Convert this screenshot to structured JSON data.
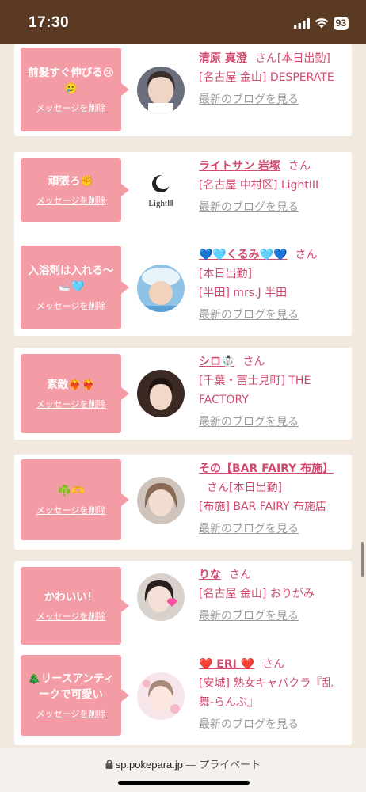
{
  "status": {
    "time": "17:30",
    "battery": "93"
  },
  "cards": [
    {
      "message": "前髪すぐ伸びる😢🥲",
      "delete": "メッセージを削除",
      "name": "清原 真澄",
      "san": "さん",
      "inline_extra": "[本日出勤]",
      "store": "[名古屋 金山] DESPERATE",
      "blog": "最新のブログを見る"
    },
    {
      "message": "頑張ろ✊",
      "delete": "メッセージを削除",
      "name": "ライトサン 岩塚",
      "san": "さん",
      "inline_extra": "",
      "store": "[名古屋 中村区] LightIII",
      "blog": "最新のブログを見る",
      "logo_text": "LightⅢ"
    },
    {
      "message": "入浴剤は入れる〜🛁🩵",
      "delete": "メッセージを削除",
      "name": "💙🩵くるみ🩵💙",
      "san": "さん",
      "inline_extra": "",
      "store": "[本日出勤]\n[半田] mrs.J 半田",
      "blog": "最新のブログを見る"
    },
    {
      "message": "素敵❤️‍🔥❤️‍🔥",
      "delete": "メッセージを削除",
      "name": "シロ☃️",
      "san": "さん",
      "inline_extra": "",
      "store": "[千葉・富士見町] THE FACTORY",
      "blog": "最新のブログを見る"
    },
    {
      "message": "☘️🫶",
      "delete": "メッセージを削除",
      "name": "その【BAR FAIRY 布施】",
      "san": "さん",
      "inline_extra": "[本日出勤]",
      "store": "[布施] BAR FAIRY 布施店",
      "blog": "最新のブログを見る"
    },
    {
      "message": "かわいい！",
      "delete": "メッセージを削除",
      "name": "りな",
      "san": "さん",
      "inline_extra": "",
      "store": "[名古屋 金山] おりがみ",
      "blog": "最新のブログを見る"
    },
    {
      "message": "🎄リースアンティークで可愛い",
      "delete": "メッセージを削除",
      "name": "❤️ ERI ❤️",
      "san": "さん",
      "inline_extra": "",
      "store": "[安城] 熟女キャバクラ『乱舞-らんぶ』",
      "blog": "最新のブログを見る"
    }
  ],
  "browser": {
    "url": "sp.pokepara.jp",
    "separator": "—",
    "mode": "プライベート"
  },
  "icons": [
    "signal-icon",
    "wifi-icon",
    "battery-icon",
    "lock-icon"
  ],
  "colors": {
    "bubble": "#f49ca6",
    "link": "#d14b6e",
    "statusbar": "#5a3a22",
    "background": "#f1e9de"
  }
}
